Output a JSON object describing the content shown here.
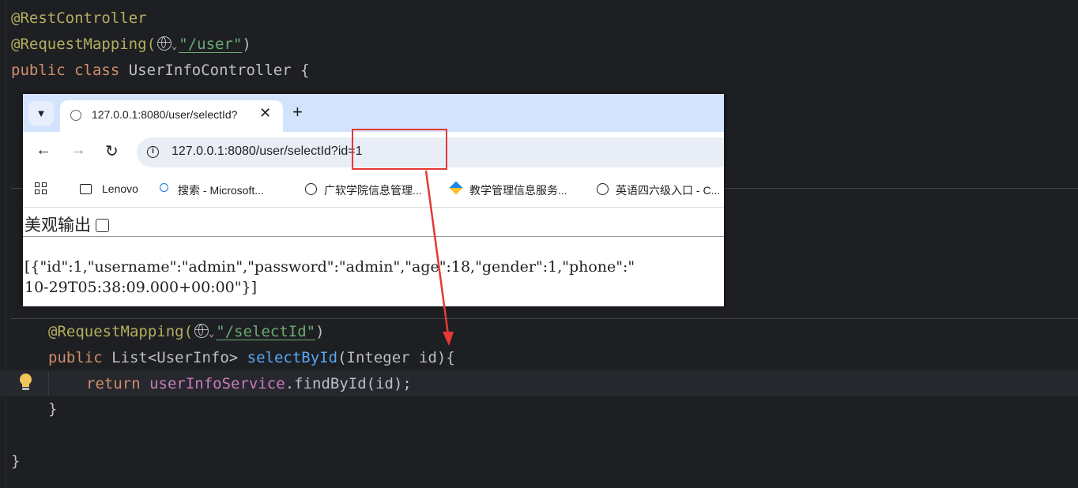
{
  "code": {
    "line1": "@RestController",
    "line2_ann": "@RequestMapping(",
    "line2_str": "\"/user\"",
    "line2_end": ")",
    "line3_kw1": "public",
    "line3_kw2": "class",
    "line3_rest": " UserInfoController {",
    "line4_ann": "@RequestMapping(",
    "line4_str": "\"/selectId\"",
    "line4_end": ")",
    "line5_kw": "public",
    "line5_type": " List<UserInfo> ",
    "line5_fn": "selectById",
    "line5_rest": "(Integer id){",
    "line6_kw": "return",
    "line6_field": "userInfoService",
    "line6_rest": ".findById(id);",
    "line7": "}",
    "line8": "}"
  },
  "browser": {
    "tab_title": "127.0.0.1:8080/user/selectId?",
    "url": "127.0.0.1:8080/user/selectId?id=1",
    "bookmarks": [
      {
        "label": "Lenovo",
        "icon": "folder-icon"
      },
      {
        "label": "搜索 - Microsoft...",
        "icon": "search-icon"
      },
      {
        "label": "广软学院信息管理...",
        "icon": "globe-icon"
      },
      {
        "label": "教学管理信息服务...",
        "icon": "cube-icon"
      },
      {
        "label": "英语四六级入口 - C...",
        "icon": "globe-icon"
      }
    ],
    "pretty_label": "美观输出",
    "json_line1": "[{\"id\":1,\"username\":\"admin\",\"password\":\"admin\",\"age\":18,\"gender\":1,\"phone\":\"",
    "json_line2": "10-29T05:38:09.000+00:00\"}]"
  },
  "colors": {
    "annotation": "#b3ae60",
    "keyword": "#cf8e6d",
    "string": "#6aab73",
    "field": "#c77dbb",
    "function": "#56a8f5",
    "highlight": "#e53935"
  }
}
